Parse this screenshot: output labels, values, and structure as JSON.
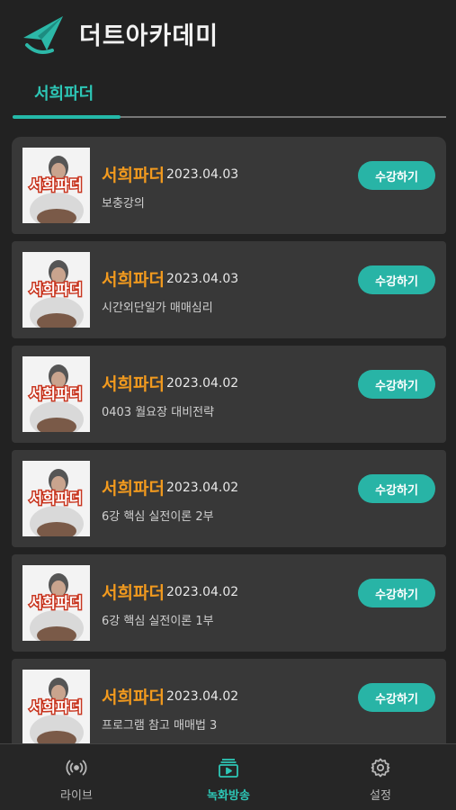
{
  "header": {
    "title": "더트아카데미",
    "logo_icon": "paper-plane-icon"
  },
  "tabs": [
    {
      "label": "서희파더",
      "active": true
    }
  ],
  "thumb_text": "서희파더",
  "enroll_label": "수강하기",
  "items": [
    {
      "title": "서희파더",
      "date": "2023.04.03",
      "subtitle": "보충강의"
    },
    {
      "title": "서희파더",
      "date": "2023.04.03",
      "subtitle": "시간외단일가 매매심리"
    },
    {
      "title": "서희파더",
      "date": "2023.04.02",
      "subtitle": "0403 월요장 대비전략"
    },
    {
      "title": "서희파더",
      "date": "2023.04.02",
      "subtitle": "6강 핵심 실전이론 2부"
    },
    {
      "title": "서희파더",
      "date": "2023.04.02",
      "subtitle": "6강 핵심 실전이론 1부"
    },
    {
      "title": "서희파더",
      "date": "2023.04.02",
      "subtitle": "프로그램 참고 매매법 3"
    }
  ],
  "bottom_nav": [
    {
      "label": "라이브",
      "icon": "broadcast-icon",
      "active": false
    },
    {
      "label": "녹화방송",
      "icon": "recorded-video-icon",
      "active": true
    },
    {
      "label": "설정",
      "icon": "gear-icon",
      "active": false
    }
  ],
  "colors": {
    "accent": "#28b4a6",
    "title_orange": "#f29a1e",
    "background": "#222222",
    "card": "#383838"
  }
}
